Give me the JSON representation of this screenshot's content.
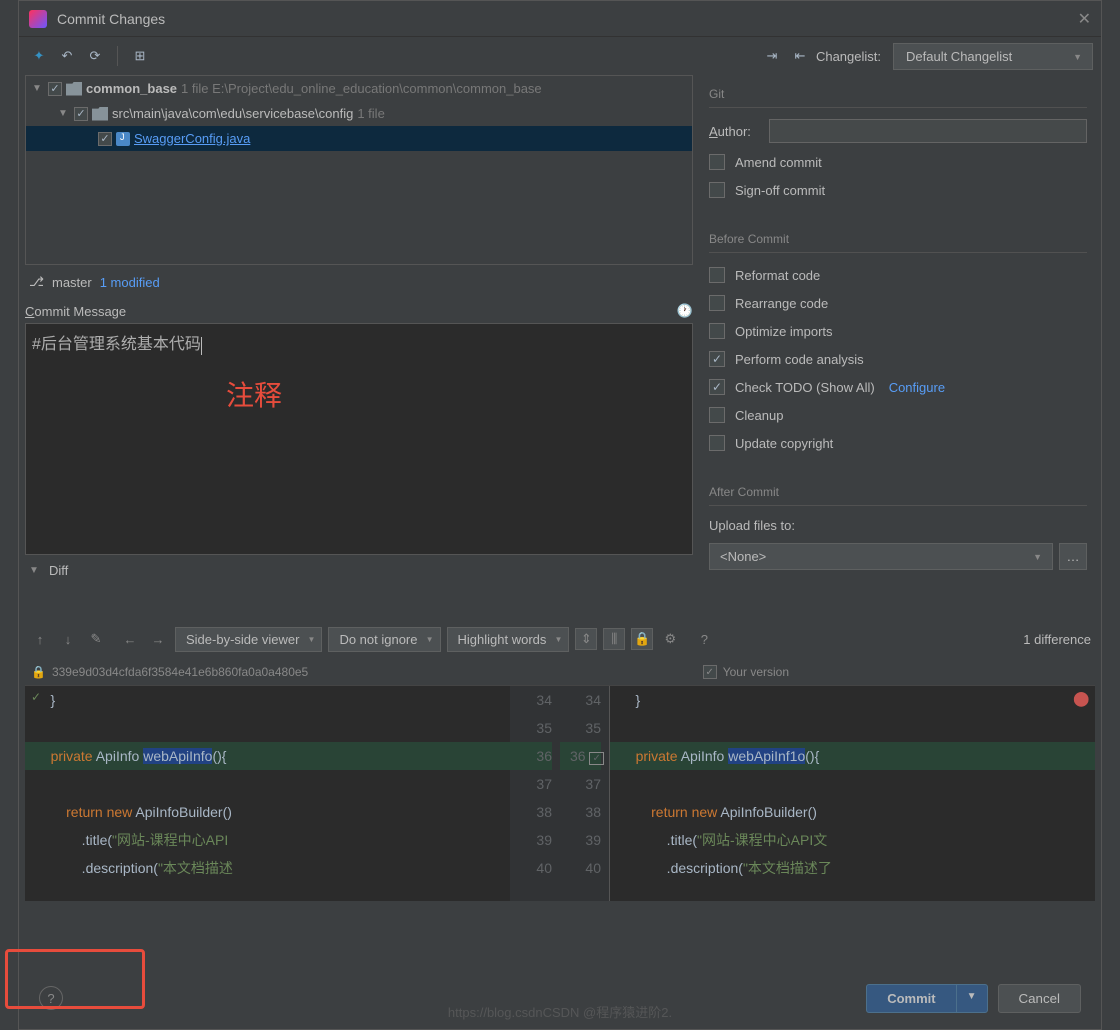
{
  "window": {
    "title": "Commit Changes"
  },
  "toolbar": {
    "changelist_label": "Changelist:",
    "changelist_value": "Default Changelist"
  },
  "tree": {
    "root": {
      "name": "common_base",
      "suffix": "1 file  E:\\Project\\edu_online_education\\common\\common_base"
    },
    "folder": {
      "name": "src\\main\\java\\com\\edu\\servicebase\\config",
      "suffix": "1 file"
    },
    "file": "SwaggerConfig.java"
  },
  "branchbar": {
    "branch": "master",
    "modified": "1 modified"
  },
  "commit_message": {
    "label_c": "C",
    "label_rest": "ommit Message",
    "text": "#后台管理系统基本代码",
    "annotation": "注释"
  },
  "git": {
    "header": "Git",
    "author_label_a": "A",
    "author_label_rest": "uthor:",
    "amend_a": "A",
    "amend_rest": "mend commit",
    "signoff": "Sign-off commit"
  },
  "before_commit": {
    "header": "Before Commit",
    "reformat_r": "R",
    "reformat_rest": "eformat code",
    "rearrange_rearra": "Rearra",
    "rearrange_n": "n",
    "rearrange_rest": "ge code",
    "optimize_o": "O",
    "optimize_rest": "ptimize imports",
    "analysis_pre": "Perform code analysi",
    "analysis_s": "s",
    "todo": "Check TODO (Show All)",
    "todo_configure": "Configure",
    "cleanup_c": "C",
    "cleanup_l": "l",
    "cleanup_rest": "eanup",
    "copyright": "Update copyright"
  },
  "after_commit": {
    "header": "After Commit",
    "upload_label": "Upload files to:",
    "upload_value": "<None>"
  },
  "diff": {
    "header": "Diff",
    "viewer": "Side-by-side viewer",
    "ignore": "Do not ignore",
    "highlight": "Highlight words",
    "count": "1 difference",
    "hash": "339e9d03d4cfda6f3584e41e6b860fa0a0a480e5",
    "your_version": "Your version",
    "lines_left": [
      "34",
      "35",
      "36",
      "37",
      "38",
      "39",
      "40"
    ],
    "lines_right": [
      "34",
      "35",
      "36",
      "37",
      "38",
      "39",
      "40"
    ]
  },
  "code": {
    "brace": "    }",
    "private": "private",
    "apiinfo": "ApiInfo",
    "method_left": "webApiInfo",
    "method_right": "webApiInf1o",
    "paren": "(){",
    "return": "return",
    "new": "new",
    "builder": "ApiInfoBuilder",
    "empty_paren": "()",
    "title_pre": "            .title(",
    "title_str": "\"网站-课程中心API",
    "title_str_r": "\"网站-课程中心API文",
    "desc_pre": "            .description(",
    "desc_str": "\"本文档描述",
    "desc_str_r": "\"本文档描述了"
  },
  "footer": {
    "commit": "Commit",
    "cancel": "Cancel"
  },
  "watermark": "https://blog.csdnCSDN @程序猿进阶2."
}
